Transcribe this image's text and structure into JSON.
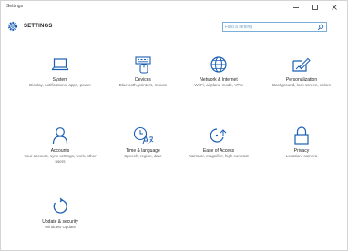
{
  "window": {
    "title": "Settings",
    "controls": {
      "minimize": "–",
      "maximize": "□",
      "close": "×"
    }
  },
  "header": {
    "title": "SETTINGS",
    "search": {
      "placeholder": "Find a setting",
      "value": ""
    }
  },
  "colors": {
    "accent": "#1a5fb4",
    "search_border": "#7aaed8"
  },
  "categories": [
    {
      "id": "system",
      "title": "System",
      "description": "Display, notifications, apps, power",
      "icon": "laptop-icon"
    },
    {
      "id": "devices",
      "title": "Devices",
      "description": "Bluetooth, printers, mouse",
      "icon": "keyboard-icon"
    },
    {
      "id": "network",
      "title": "Network & Internet",
      "description": "Wi-Fi, airplane mode, VPN",
      "icon": "globe-icon"
    },
    {
      "id": "personalization",
      "title": "Personalization",
      "description": "Background, lock screen, colors",
      "icon": "paintbrush-icon"
    },
    {
      "id": "accounts",
      "title": "Accounts",
      "description": "Your account, sync settings, work, other users",
      "icon": "person-icon"
    },
    {
      "id": "time-language",
      "title": "Time & language",
      "description": "Speech, region, date",
      "icon": "clock-language-icon"
    },
    {
      "id": "ease-of-access",
      "title": "Ease of Access",
      "description": "Narrator, magnifier, high contrast",
      "icon": "accessibility-icon"
    },
    {
      "id": "privacy",
      "title": "Privacy",
      "description": "Location, camera",
      "icon": "lock-icon"
    },
    {
      "id": "update-security",
      "title": "Update & security",
      "description": "Windows Update",
      "icon": "refresh-icon"
    }
  ]
}
